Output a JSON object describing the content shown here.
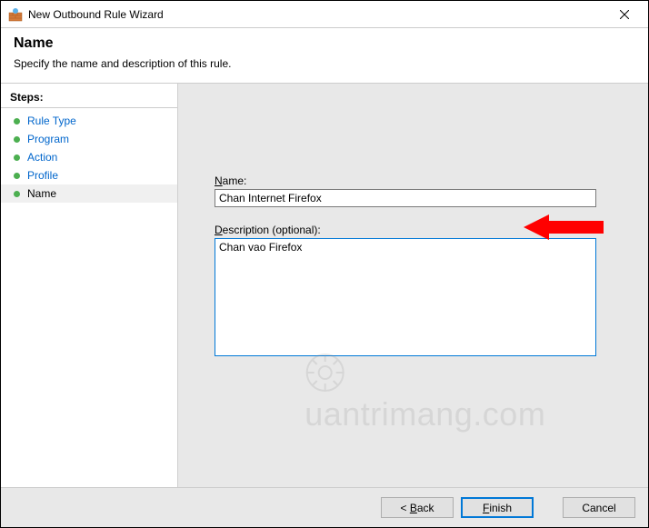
{
  "window": {
    "title": "New Outbound Rule Wizard"
  },
  "header": {
    "title": "Name",
    "subtitle": "Specify the name and description of this rule."
  },
  "steps": {
    "title": "Steps:",
    "items": [
      {
        "label": "Rule Type",
        "state": "done"
      },
      {
        "label": "Program",
        "state": "done"
      },
      {
        "label": "Action",
        "state": "done"
      },
      {
        "label": "Profile",
        "state": "done"
      },
      {
        "label": "Name",
        "state": "current"
      }
    ]
  },
  "form": {
    "name_label_pre": "",
    "name_label_u": "N",
    "name_label_post": "ame:",
    "name_value": "Chan Internet Firefox",
    "desc_label_pre": "",
    "desc_label_u": "D",
    "desc_label_post": "escription (optional):",
    "desc_value": "Chan vao Firefox"
  },
  "buttons": {
    "back_pre": "< ",
    "back_u": "B",
    "back_post": "ack",
    "finish_pre": "",
    "finish_u": "F",
    "finish_post": "inish",
    "cancel": "Cancel"
  },
  "watermark": {
    "text": "uantrimang.com"
  }
}
